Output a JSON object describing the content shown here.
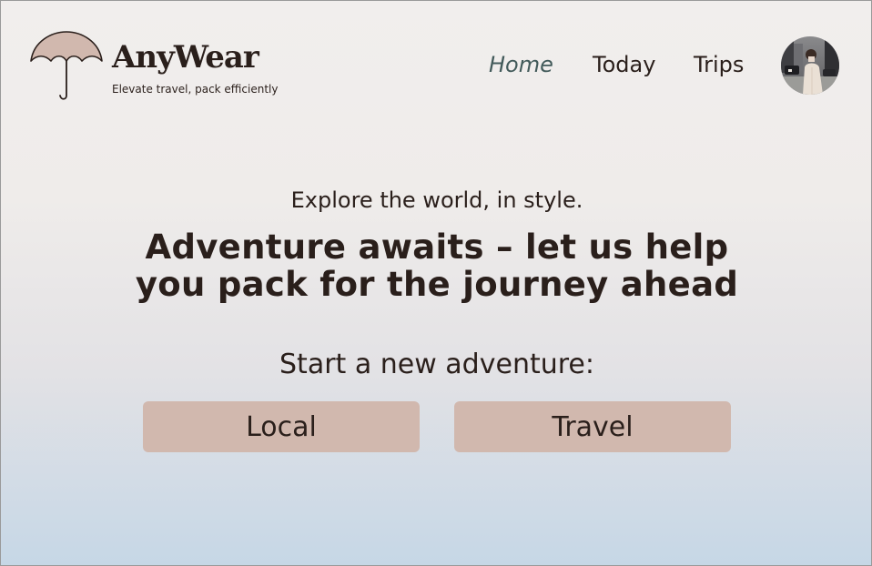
{
  "brand": {
    "name": "AnyWear",
    "tagline": "Elevate travel, pack efficiently",
    "logo_icon": "umbrella-icon",
    "logo_color": "#d1b8ae"
  },
  "nav": {
    "items": [
      {
        "label": "Home",
        "active": true
      },
      {
        "label": "Today",
        "active": false
      },
      {
        "label": "Trips",
        "active": false
      }
    ],
    "active_color": "#425a5a"
  },
  "profile": {
    "avatar": "user-avatar-photo"
  },
  "hero": {
    "subtitle": "Explore the world, in style.",
    "title": "Adventure awaits – let us help you pack for the journey ahead",
    "start_label": "Start a new adventure:"
  },
  "actions": {
    "local_label": "Local",
    "travel_label": "Travel",
    "button_color": "#d1b8ae"
  },
  "colors": {
    "text": "#2a1f1b",
    "background_top": "#f1eeed",
    "background_bottom": "#c6d7e6"
  }
}
